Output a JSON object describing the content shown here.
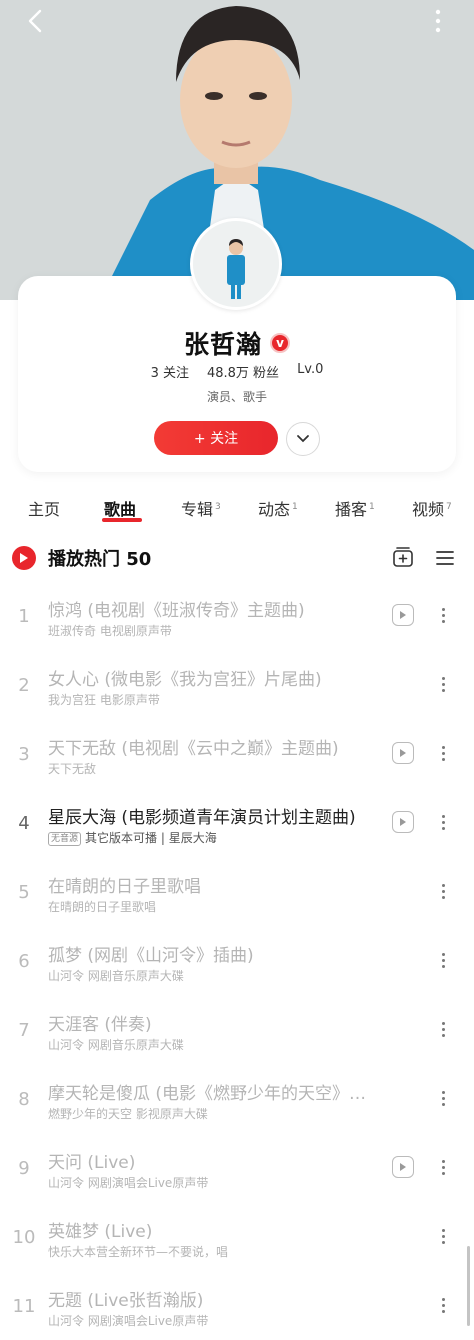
{
  "artist": {
    "name": "张哲瀚",
    "badge": "v",
    "following": "3 关注",
    "fans": "48.8万 粉丝",
    "level": "Lv.0",
    "roles": "演员、歌手",
    "follow_label": "+ 关注"
  },
  "tabs": [
    {
      "label": "主页",
      "count": ""
    },
    {
      "label": "歌曲",
      "count": ""
    },
    {
      "label": "专辑",
      "count": "3"
    },
    {
      "label": "动态",
      "count": "1"
    },
    {
      "label": "播客",
      "count": "1"
    },
    {
      "label": "视频",
      "count": "7"
    }
  ],
  "play_header": {
    "label": "播放热门 50"
  },
  "songs": [
    {
      "index": "1",
      "title": "惊鸿 (电视剧《班淑传奇》主题曲)",
      "subtitle": "班淑传奇 电视剧原声带",
      "has_mv": true,
      "playable": false,
      "badge": ""
    },
    {
      "index": "2",
      "title": "女人心 (微电影《我为宫狂》片尾曲)",
      "subtitle": "我为宫狂 电影原声带",
      "has_mv": false,
      "playable": false,
      "badge": ""
    },
    {
      "index": "3",
      "title": "天下无敌 (电视剧《云中之巅》主题曲)",
      "subtitle": "天下无敌",
      "has_mv": true,
      "playable": false,
      "badge": ""
    },
    {
      "index": "4",
      "title": "星辰大海 (电影频道青年演员计划主题曲)",
      "subtitle": "其它版本可播 | 星辰大海",
      "has_mv": true,
      "playable": true,
      "badge": "无音源"
    },
    {
      "index": "5",
      "title": "在晴朗的日子里歌唱",
      "subtitle": "在晴朗的日子里歌唱",
      "has_mv": false,
      "playable": false,
      "badge": ""
    },
    {
      "index": "6",
      "title": "孤梦 (网剧《山河令》插曲)",
      "subtitle": "山河令 网剧音乐原声大碟",
      "has_mv": false,
      "playable": false,
      "badge": ""
    },
    {
      "index": "7",
      "title": "天涯客 (伴奏)",
      "subtitle": "山河令 网剧音乐原声大碟",
      "has_mv": false,
      "playable": false,
      "badge": ""
    },
    {
      "index": "8",
      "title": "摩天轮是傻瓜 (电影《燃野少年的天空》插曲)",
      "subtitle": "燃野少年的天空 影视原声大碟",
      "has_mv": false,
      "playable": false,
      "badge": ""
    },
    {
      "index": "9",
      "title": "天问 (Live)",
      "subtitle": "山河令 网剧演唱会Live原声带",
      "has_mv": true,
      "playable": false,
      "badge": ""
    },
    {
      "index": "10",
      "title": "英雄梦 (Live)",
      "subtitle": "快乐大本营全新环节—不要说，唱",
      "has_mv": false,
      "playable": false,
      "badge": ""
    },
    {
      "index": "11",
      "title": "无题 (Live张哲瀚版)",
      "subtitle": "山河令 网剧演唱会Live原声带",
      "has_mv": false,
      "playable": false,
      "badge": ""
    }
  ],
  "icons": {
    "back": "chevron-left-icon",
    "more": "vertical-dots-icon",
    "verified": "verified-badge-icon",
    "expand": "chevron-down-icon",
    "play": "play-circle-icon",
    "add_to_list": "add-to-playlist-icon",
    "menu": "hamburger-menu-icon",
    "mv": "video-play-icon"
  },
  "colors": {
    "accent": "#e8262c",
    "hero_bg": "#d3d8d8",
    "jacket": "#1f8fc7"
  }
}
